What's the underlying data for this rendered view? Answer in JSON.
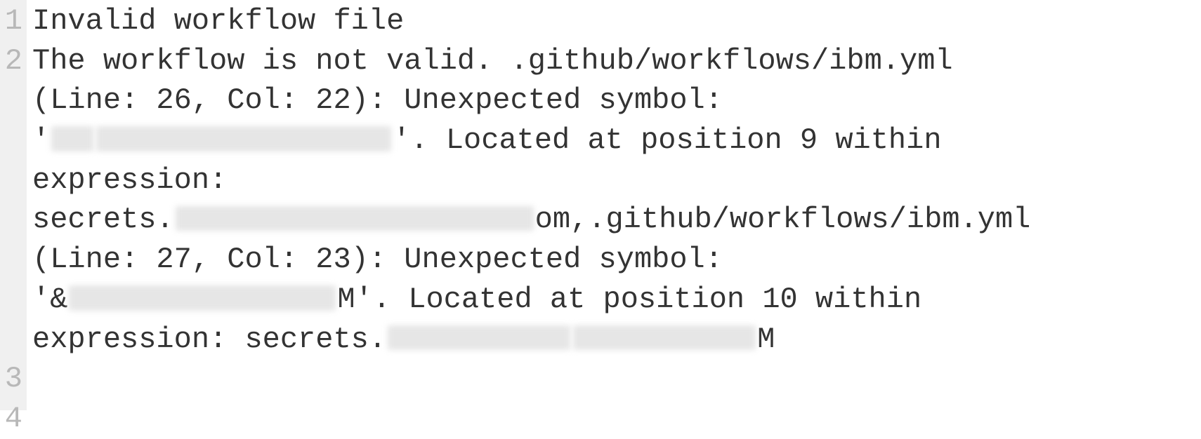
{
  "gutter": {
    "l1": "1",
    "l2": "2",
    "l3": "3",
    "l4": "4"
  },
  "code": {
    "line1": "Invalid workflow file",
    "seg": {
      "a1": "The workflow is not valid. .github/workflows/ibm.yml",
      "a2": " (Line: 26, Col: 22): Unexpected symbol:",
      "a3_pre": " '",
      "a3_post": "'. Located at position 9 within",
      "a4": " expression:",
      "a5_pre": " secrets.",
      "a5_mid": "om,.github/workflows/ibm.yml",
      "a6": " (Line: 27, Col: 23): Unexpected symbol:",
      "a7_pre": " '&",
      "a7_mid": "M'. Located at position 10 within",
      "a8_pre": " expression: secrets.",
      "a8_post": "M"
    },
    "line3": "",
    "line4": ""
  }
}
